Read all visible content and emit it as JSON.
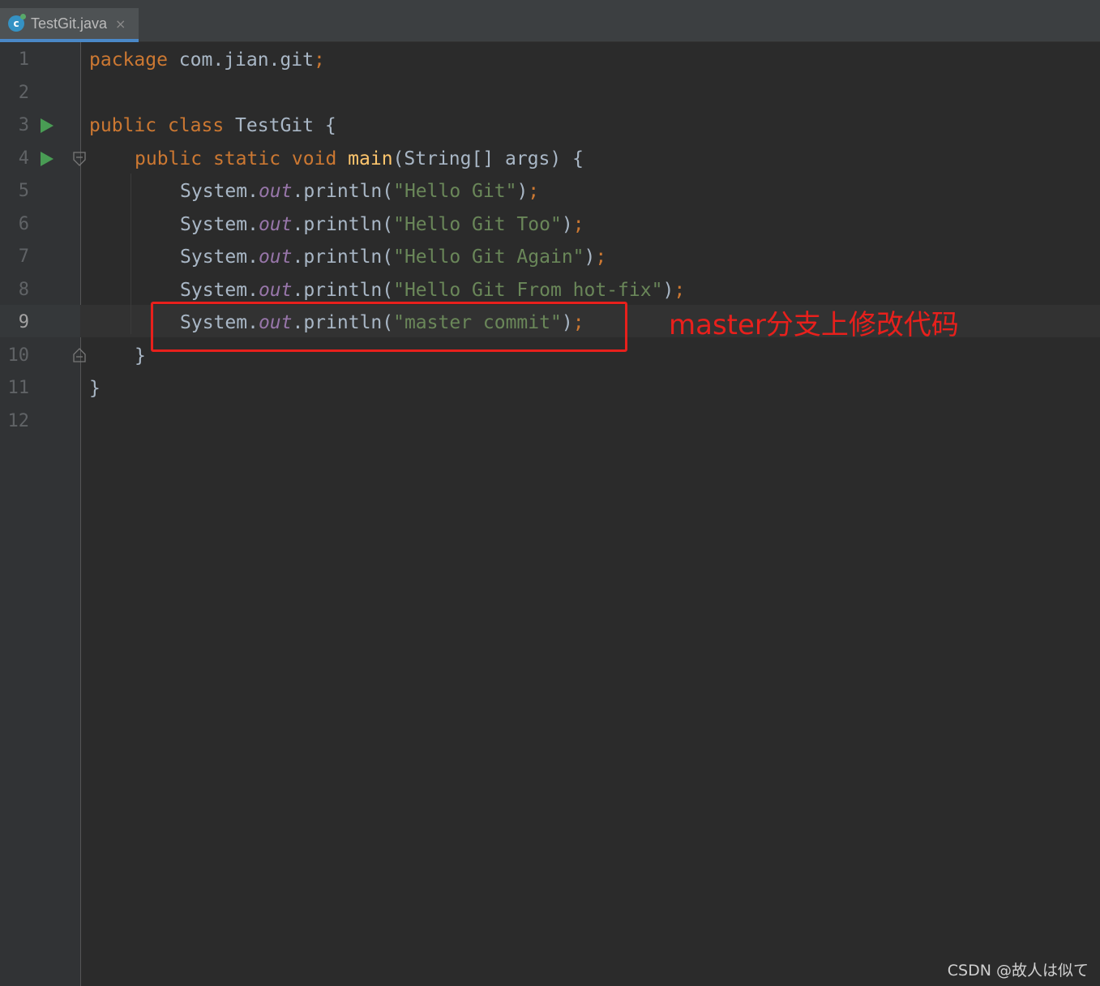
{
  "tab": {
    "filename": "TestGit.java",
    "close_symbol": "×",
    "icon": "java-class-icon",
    "icon_letter": "c"
  },
  "lines": [
    {
      "number": "1"
    },
    {
      "number": "2"
    },
    {
      "number": "3"
    },
    {
      "number": "4"
    },
    {
      "number": "5"
    },
    {
      "number": "6"
    },
    {
      "number": "7"
    },
    {
      "number": "8"
    },
    {
      "number": "9"
    },
    {
      "number": "10"
    },
    {
      "number": "11"
    },
    {
      "number": "12"
    }
  ],
  "code": {
    "line1": {
      "kw": "package",
      "rest": " com.jian.git",
      "semi": ";"
    },
    "line3": {
      "kw1": "public",
      "kw2": "class",
      "name": " TestGit {"
    },
    "line4": {
      "kw1": "public",
      "kw2": "static",
      "kw3": "void",
      "fn": "main",
      "rest": "(String[] args) {"
    },
    "prints": [
      {
        "obj": "System.",
        "field": "out",
        "call": ".println(",
        "str": "\"Hello Git\"",
        "close": ")",
        "semi": ";"
      },
      {
        "obj": "System.",
        "field": "out",
        "call": ".println(",
        "str": "\"Hello Git Too\"",
        "close": ")",
        "semi": ";"
      },
      {
        "obj": "System.",
        "field": "out",
        "call": ".println(",
        "str": "\"Hello Git Again\"",
        "close": ")",
        "semi": ";"
      },
      {
        "obj": "System.",
        "field": "out",
        "call": ".println(",
        "str": "\"Hello Git From hot-fix\"",
        "close": ")",
        "semi": ";"
      },
      {
        "obj": "System.",
        "field": "out",
        "call": ".println(",
        "str": "\"master commit\"",
        "close": ")",
        "semi": ";"
      }
    ],
    "line10": "}",
    "line11": "}"
  },
  "annotation": "master分支上修改代码",
  "watermark": "CSDN @故人は似て",
  "colors": {
    "background": "#2b2b2b",
    "keyword": "#cc7832",
    "string": "#6a8759",
    "field": "#9876aa",
    "function": "#ffc66d",
    "annotation": "#e8201c",
    "run_icon": "#499c54"
  }
}
